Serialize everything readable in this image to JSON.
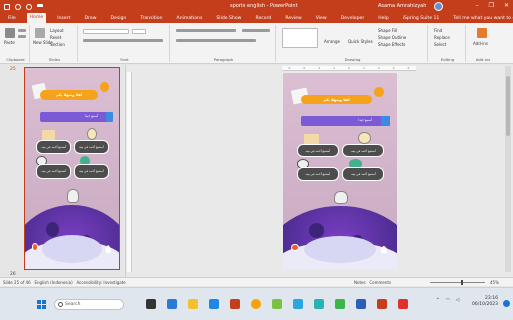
{
  "window": {
    "title": "sports english - PowerPoint",
    "user": "Asama Amrahizyah",
    "controls": {
      "minimize": "–",
      "restore": "❐",
      "close": "✕"
    }
  },
  "ribbon_tabs": [
    {
      "label": "File",
      "active": false
    },
    {
      "label": "Home",
      "active": true
    },
    {
      "label": "Insert",
      "active": false
    },
    {
      "label": "Draw",
      "active": false
    },
    {
      "label": "Design",
      "active": false
    },
    {
      "label": "Transition",
      "active": false
    },
    {
      "label": "Animations",
      "active": false
    },
    {
      "label": "Slide Show",
      "active": false
    },
    {
      "label": "Record",
      "active": false
    },
    {
      "label": "Review",
      "active": false
    },
    {
      "label": "View",
      "active": false
    },
    {
      "label": "Developer",
      "active": false
    },
    {
      "label": "Help",
      "active": false
    },
    {
      "label": "iSpring Suite 11",
      "active": false
    }
  ],
  "tell_me": "Tell me what you want to do",
  "ribbon": {
    "clipboard": {
      "label": "Clipboard",
      "paste": "Paste"
    },
    "slides": {
      "label": "Slides",
      "new_slide": "New Slide",
      "layout": "Layout",
      "reset": "Reset",
      "section": "Section"
    },
    "font": {
      "label": "Font"
    },
    "paragraph": {
      "label": "Paragraph"
    },
    "drawing": {
      "label": "Drawing",
      "arrange": "Arrange",
      "quick_styles": "Quick Styles",
      "shape_fill": "Shape Fill",
      "shape_outline": "Shape Outline",
      "shape_effects": "Shape Effects"
    },
    "editing": {
      "label": "Editing",
      "find": "Find",
      "replace": "Replace",
      "select": "Select"
    },
    "addins": {
      "label": "Add-ins",
      "addins": "Add-ins"
    }
  },
  "slide_number": "25",
  "slide_number_next": "26",
  "ruler": [
    "8",
    "6",
    "4",
    "2",
    "0",
    "2",
    "4",
    "6",
    "8"
  ],
  "slide": {
    "title": "أهلا وسهلا بكم",
    "subtitle": "أسمع جيدا",
    "buttons": [
      "أستمع أحمد في بيته",
      "أستمع أحمد في بيته",
      "أستمع أحمد في بيته",
      "أستمع أحمد في بيته"
    ]
  },
  "status": {
    "slide_of": "Slide 25 of 46",
    "language": "English (Indonesia)",
    "accessibility": "Accessibility: Investigate",
    "notes": "Notes",
    "comments": "Comments",
    "zoom": "45%"
  },
  "taskbar": {
    "search_placeholder": "Search",
    "time": "23:16",
    "date": "06/10/2023"
  },
  "colors": {
    "accent": "#c43e1c",
    "slide_bg": "#dcbfd3",
    "title_pill": "#f7a21b",
    "subtitle_bar": "#7c5ad6",
    "planet": "#4a2b8f"
  }
}
